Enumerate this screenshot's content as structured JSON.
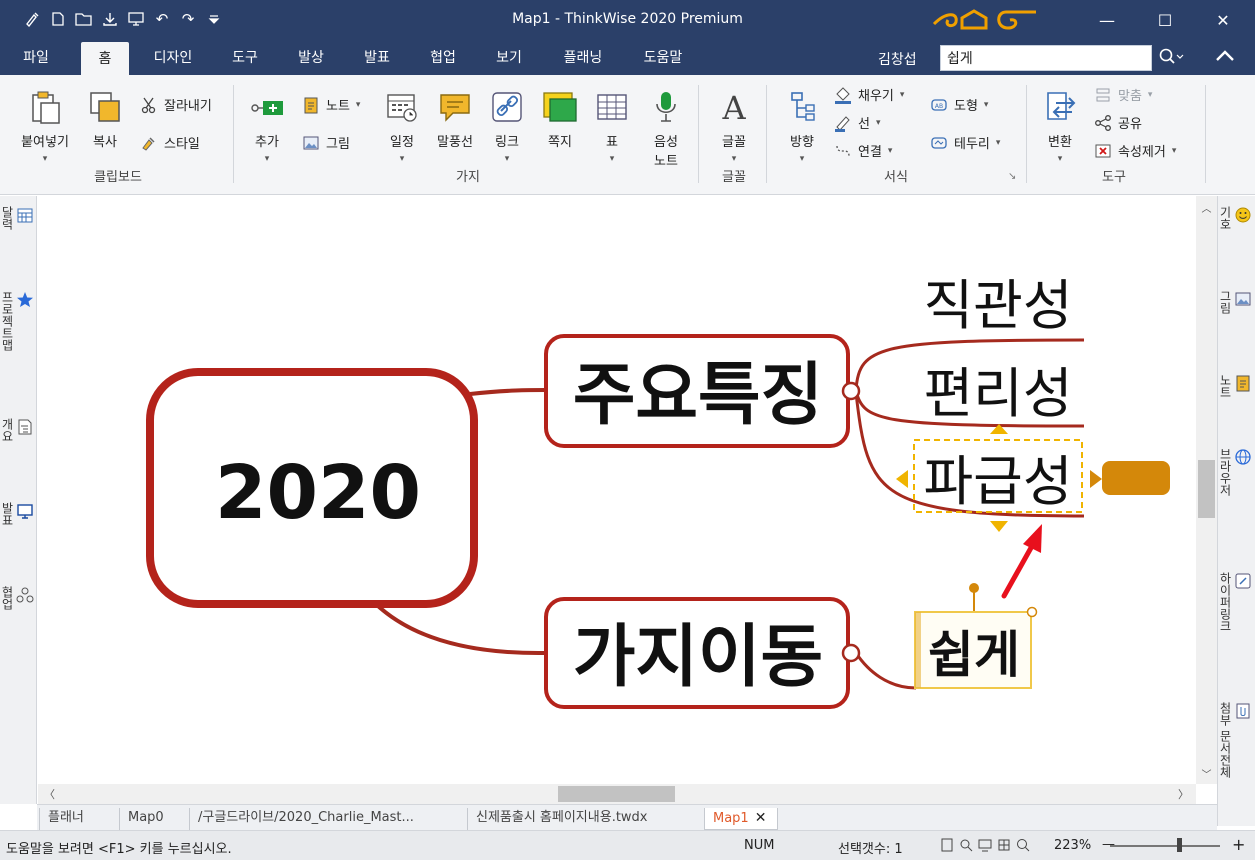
{
  "window": {
    "title": "Map1 -  ThinkWise 2020 Premium",
    "minimize": "—",
    "maximize": "☐",
    "close": "✕"
  },
  "qat": [
    "brush-icon",
    "new-icon",
    "open-icon",
    "save-icon",
    "present-icon",
    "undo-icon",
    "redo-icon",
    "customize-icon"
  ],
  "menu": {
    "tabs": [
      {
        "label": "파일"
      },
      {
        "label": "홈"
      },
      {
        "label": "디자인"
      },
      {
        "label": "도구"
      },
      {
        "label": "발상"
      },
      {
        "label": "발표"
      },
      {
        "label": "협업"
      },
      {
        "label": "보기"
      },
      {
        "label": "플래닝"
      },
      {
        "label": "도움말"
      }
    ],
    "active_tab": "홈",
    "user": "김창섭",
    "search_value": "쉽게"
  },
  "ribbon": {
    "clipboard": {
      "paste": "붙여넣기",
      "copy": "복사",
      "cut": "잘라내기",
      "style": "스타일",
      "group": "클립보드"
    },
    "branch": {
      "add": "추가",
      "note": "노트",
      "image": "그림",
      "schedule": "일정",
      "balloon": "말풍선",
      "link": "링크",
      "memo": "쪽지",
      "table": "표",
      "voice": "음성",
      "voice2": "노트",
      "group": "가지"
    },
    "font": {
      "font": "글꼴",
      "group": "글꼴"
    },
    "format": {
      "direction": "방향",
      "fill": "채우기",
      "line": "선",
      "connect": "연결",
      "shape": "도형",
      "border": "테두리",
      "group": "서식"
    },
    "tools": {
      "convert": "변환",
      "fit": "맞춤",
      "share": "공유",
      "remove_attr": "속성제거",
      "group": "도구"
    }
  },
  "left_sidebar": [
    {
      "label": "달력",
      "icon": "calendar-icon"
    },
    {
      "label": "프로젝트맵",
      "icon": "star-icon"
    },
    {
      "label": "개요",
      "icon": "outline-icon"
    },
    {
      "label": "발표",
      "icon": "presentation-icon"
    },
    {
      "label": "협업",
      "icon": "collab-icon"
    }
  ],
  "right_sidebar": [
    {
      "label": "기호",
      "icon": "smiley-icon"
    },
    {
      "label": "그림",
      "icon": "picture-icon"
    },
    {
      "label": "노트",
      "icon": "note-icon"
    },
    {
      "label": "브라우저",
      "icon": "globe-icon"
    },
    {
      "label": "하이퍼링크",
      "icon": "hyperlink-icon"
    },
    {
      "label": "첨부 문서전체",
      "icon": "attach-icon"
    }
  ],
  "map": {
    "central": "2020",
    "main_topics": [
      {
        "label": "주요특징",
        "subtopics": [
          "직관성",
          "편리성",
          "파급성"
        ]
      },
      {
        "label": "가지이동",
        "subtopics": [
          "쉽게"
        ]
      }
    ],
    "colors": {
      "branch": "#a52a1e",
      "node_border": "#b4231b",
      "selection": "#f0b400",
      "handle": "#d4880a",
      "arrow": "#e8101d"
    }
  },
  "doc_tabs": [
    {
      "label": "플래너"
    },
    {
      "label": "Map0"
    },
    {
      "label": "/구글드라이브/2020_Charlie_Mast..."
    },
    {
      "label": "신제품출시 홈페이지내용.twdx"
    },
    {
      "label": "Map1",
      "active": true
    }
  ],
  "status": {
    "help": "도움말을 보려면 <F1> 키를 누르십시오.",
    "num": "NUM",
    "selection_count": "선택갯수: 1",
    "zoom": "223%",
    "zoom_minus": "—",
    "zoom_plus": "+"
  }
}
